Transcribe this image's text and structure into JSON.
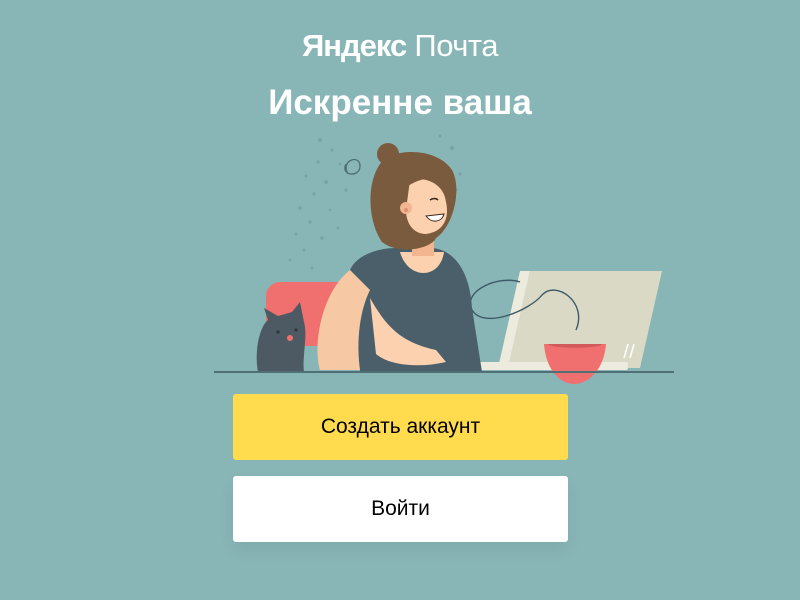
{
  "logo": {
    "brand": "Яндекс",
    "product": "Почта"
  },
  "headline": "Искренне ваша",
  "buttons": {
    "create_account": "Создать аккаунт",
    "login": "Войти"
  },
  "colors": {
    "background": "#88b5b6",
    "primary_button": "#ffdb4d",
    "secondary_button": "#ffffff",
    "text_light": "#ffffff"
  },
  "illustration": {
    "icons": [
      "woman-icon",
      "cat-icon",
      "laptop-icon",
      "cup-icon",
      "chair-icon"
    ]
  }
}
